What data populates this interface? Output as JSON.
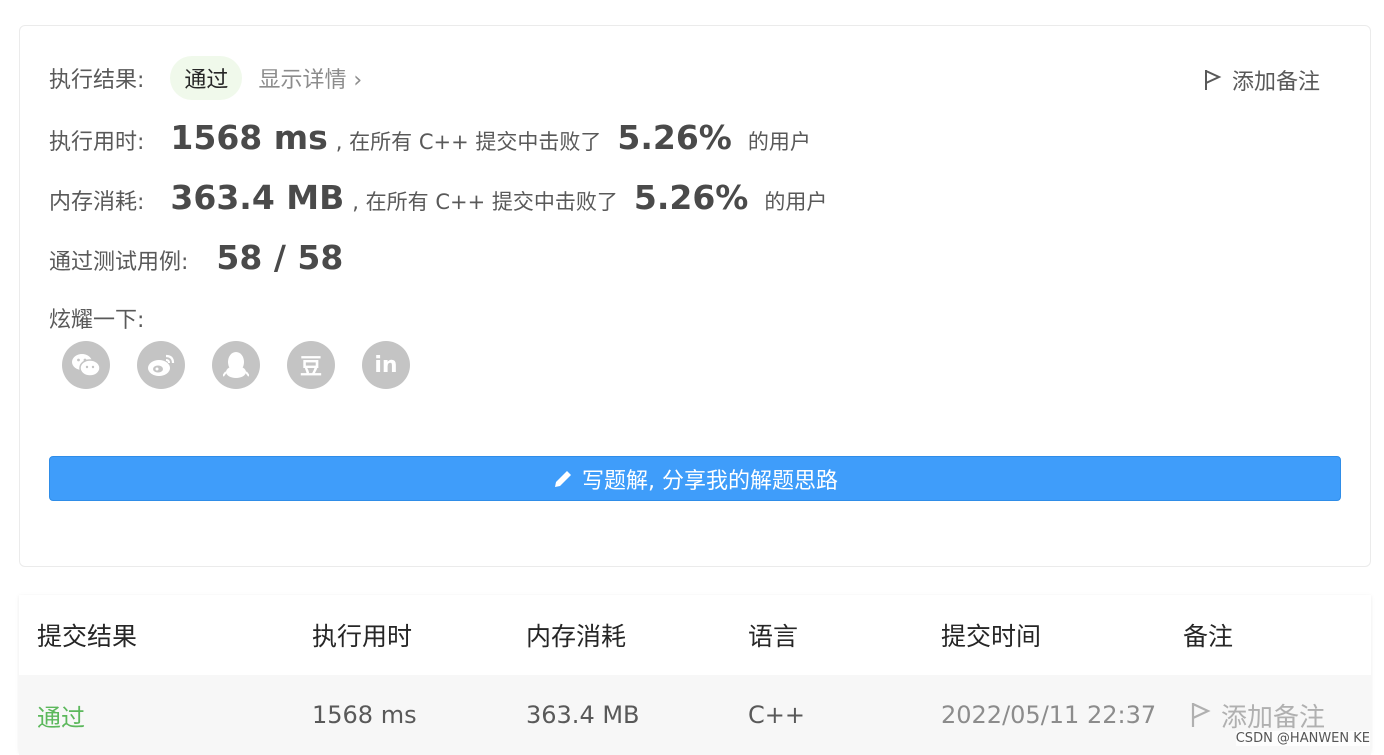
{
  "result": {
    "label": "执行结果:",
    "status": "通过",
    "detail_link": "显示详情 ›",
    "add_note": "添加备注"
  },
  "runtime": {
    "label": "执行用时:",
    "value": "1568 ms",
    "mid_text": ", 在所有 C++ 提交中击败了",
    "percent": "5.26%",
    "suffix": "的用户"
  },
  "memory": {
    "label": "内存消耗:",
    "value": "363.4 MB",
    "mid_text": ", 在所有 C++ 提交中击败了",
    "percent": "5.26%",
    "suffix": "的用户"
  },
  "testcases": {
    "label": "通过测试用例:",
    "value": "58 / 58"
  },
  "share": {
    "label": "炫耀一下:",
    "icons": [
      "wechat-icon",
      "weibo-icon",
      "qq-icon",
      "douban-icon",
      "linkedin-icon"
    ],
    "douban_glyph": "豆",
    "linkedin_glyph": "in"
  },
  "write_solution": "写题解, 分享我的解题思路",
  "table": {
    "headers": [
      "提交结果",
      "执行用时",
      "内存消耗",
      "语言",
      "提交时间",
      "备注"
    ],
    "rows": [
      {
        "status": "通过",
        "runtime": "1568 ms",
        "memory": "363.4 MB",
        "language": "C++",
        "time": "2022/05/11 22:37",
        "note": "添加备注"
      }
    ]
  },
  "watermark": "CSDN @HANWEN KE",
  "colors": {
    "accent": "#3f9dfa",
    "success": "#5cb85c",
    "badge_bg": "#f0f9eb"
  }
}
